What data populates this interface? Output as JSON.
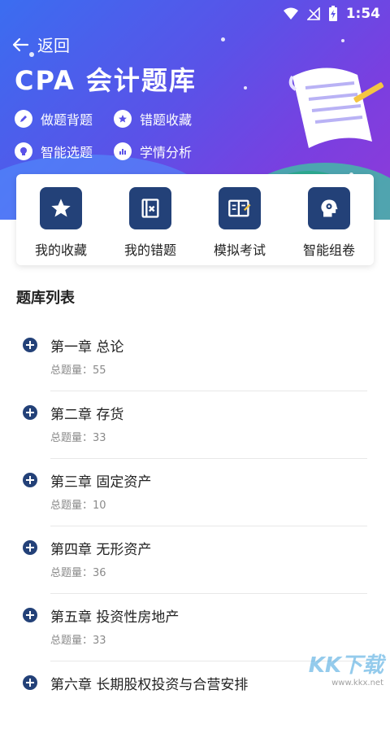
{
  "status_bar": {
    "time": "1:54"
  },
  "header": {
    "back_label": "返回",
    "title": "CPA 会计题库",
    "features": [
      {
        "label": "做题背题",
        "icon": "edit-icon"
      },
      {
        "label": "错题收藏",
        "icon": "star-icon"
      },
      {
        "label": "智能选题",
        "icon": "brain-icon"
      },
      {
        "label": "学情分析",
        "icon": "chart-icon"
      }
    ]
  },
  "quick_actions": [
    {
      "label": "我的收藏",
      "icon": "star-icon"
    },
    {
      "label": "我的错题",
      "icon": "wrong-book-icon"
    },
    {
      "label": "模拟考试",
      "icon": "exam-icon"
    },
    {
      "label": "智能组卷",
      "icon": "smart-head-icon"
    }
  ],
  "section": {
    "title": "题库列表"
  },
  "chapters": [
    {
      "title": "第一章 总论",
      "count_label": "总题量：",
      "count": "55"
    },
    {
      "title": "第二章 存货",
      "count_label": "总题量：",
      "count": "33"
    },
    {
      "title": "第三章 固定资产",
      "count_label": "总题量：",
      "count": "10"
    },
    {
      "title": "第四章 无形资产",
      "count_label": "总题量：",
      "count": "36"
    },
    {
      "title": "第五章 投资性房地产",
      "count_label": "总题量：",
      "count": "33"
    },
    {
      "title": "第六章 长期股权投资与合营安排",
      "count_label": "",
      "count": ""
    }
  ],
  "watermark": {
    "main": "KK下载",
    "sub": "www.kkx.net"
  },
  "colors": {
    "accent": "#234178",
    "hero_start": "#3b6df0",
    "hero_end": "#8f3ad8"
  }
}
